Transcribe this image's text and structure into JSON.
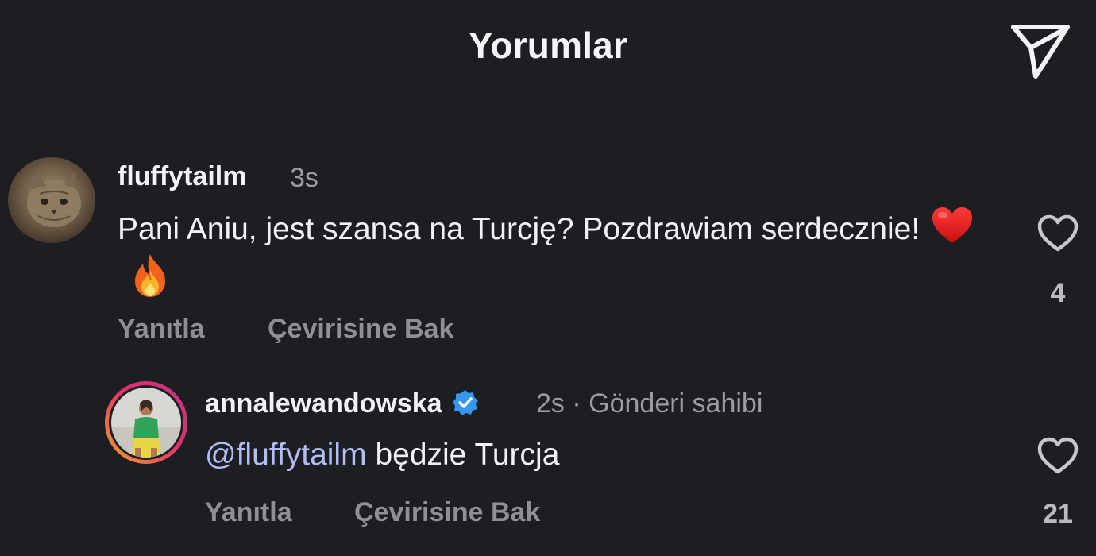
{
  "header": {
    "title": "Yorumlar",
    "share_icon": "paper-plane-icon"
  },
  "comments": [
    {
      "username": "fluffytailm",
      "time": "3s",
      "text": "Pani Aniu, jest szansa na Turcję? Pozdrawiam serdecznie!",
      "emojis": [
        "❤️",
        "🔥"
      ],
      "reply_label": "Yanıtla",
      "translate_label": "Çevirisine Bak",
      "like_count": "4",
      "like_icon": "heart-outline-icon",
      "avatar_icon": "cat-avatar"
    },
    {
      "username": "annalewandowska",
      "verified": true,
      "time": "2s",
      "separator": "·",
      "owner_label": "Gönderi sahibi",
      "mention": "@fluffytailm",
      "text": "będzie Turcja",
      "reply_label": "Yanıtla",
      "translate_label": "Çevirisine Bak",
      "like_count": "21",
      "like_icon": "heart-outline-icon",
      "avatar_icon": "story-ring-avatar"
    }
  ],
  "colors": {
    "background": "#1d1e22",
    "text": "#f2f2f4",
    "muted": "#9b9ba3",
    "mention": "#b3bdf5",
    "verified": "#3797f0",
    "story_ring_start": "#f9a326",
    "story_ring_end": "#d62976"
  }
}
